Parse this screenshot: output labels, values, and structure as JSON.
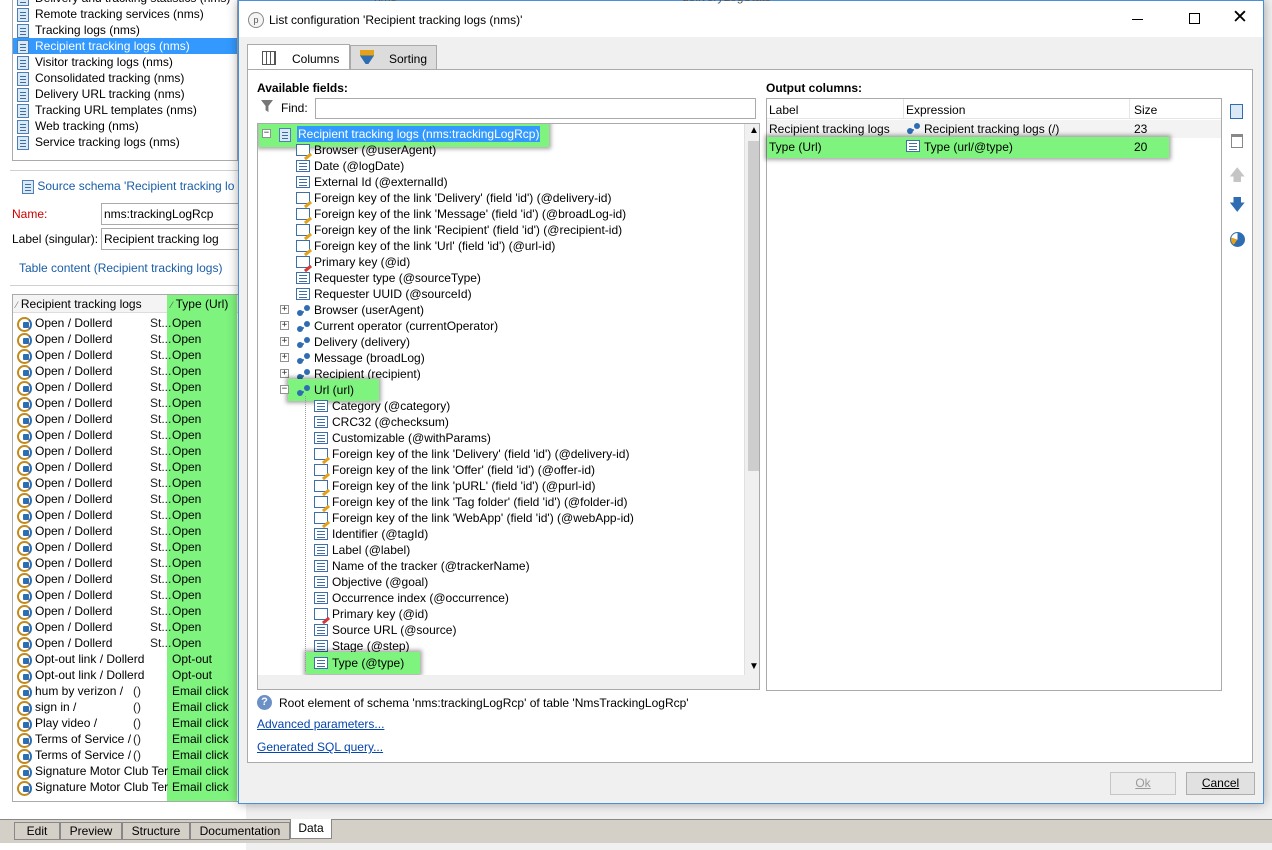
{
  "left_panel": {
    "top_items": [
      {
        "label": "Delivery and tracking statistics (nms)",
        "icon": "document-icon",
        "selected": false
      },
      {
        "label": "Remote tracking services (nms)",
        "icon": "document-icon",
        "selected": false
      },
      {
        "label": "Tracking logs (nms)",
        "icon": "document-icon",
        "selected": false
      },
      {
        "label": "Recipient tracking logs (nms)",
        "icon": "document-icon",
        "selected": true
      },
      {
        "label": "Visitor tracking logs (nms)",
        "icon": "document-icon",
        "selected": false
      },
      {
        "label": "Consolidated tracking (nms)",
        "icon": "document-icon",
        "selected": false
      },
      {
        "label": "Delivery URL tracking (nms)",
        "icon": "user-document-icon",
        "selected": false
      },
      {
        "label": "Tracking URL templates (nms)",
        "icon": "document-icon",
        "selected": false
      },
      {
        "label": "Web tracking (nms)",
        "icon": "document-icon",
        "selected": false
      },
      {
        "label": "Service tracking logs (nms)",
        "icon": "document-icon",
        "selected": false
      }
    ],
    "bg_col2_texts": [
      "nms",
      "deliveryLogStats"
    ],
    "source_schema_link": "Source schema 'Recipient tracking lo",
    "name_label": "Name:",
    "name_value": "nms:trackingLogRcp",
    "label_singular_label": "Label (singular):",
    "label_singular_value": "Recipient tracking log",
    "table_content_label": "Table content (Recipient tracking logs)",
    "grid_headers": [
      "Recipient tracking logs",
      "Type (Url)"
    ],
    "grid_rows": [
      {
        "c1": "Open / Dollerd",
        "c2": "St...",
        "c3": "Open"
      },
      {
        "c1": "Open / Dollerd",
        "c2": "St...",
        "c3": "Open"
      },
      {
        "c1": "Open / Dollerd",
        "c2": "St...",
        "c3": "Open"
      },
      {
        "c1": "Open / Dollerd",
        "c2": "St...",
        "c3": "Open"
      },
      {
        "c1": "Open / Dollerd",
        "c2": "St...",
        "c3": "Open"
      },
      {
        "c1": "Open / Dollerd",
        "c2": "St...",
        "c3": "Open"
      },
      {
        "c1": "Open / Dollerd",
        "c2": "St...",
        "c3": "Open"
      },
      {
        "c1": "Open / Dollerd",
        "c2": "St...",
        "c3": "Open"
      },
      {
        "c1": "Open / Dollerd",
        "c2": "St...",
        "c3": "Open"
      },
      {
        "c1": "Open / Dollerd",
        "c2": "St...",
        "c3": "Open"
      },
      {
        "c1": "Open / Dollerd",
        "c2": "St...",
        "c3": "Open"
      },
      {
        "c1": "Open / Dollerd",
        "c2": "St...",
        "c3": "Open"
      },
      {
        "c1": "Open / Dollerd",
        "c2": "St...",
        "c3": "Open"
      },
      {
        "c1": "Open / Dollerd",
        "c2": "St...",
        "c3": "Open"
      },
      {
        "c1": "Open / Dollerd",
        "c2": "St...",
        "c3": "Open"
      },
      {
        "c1": "Open / Dollerd",
        "c2": "St...",
        "c3": "Open"
      },
      {
        "c1": "Open / Dollerd",
        "c2": "St...",
        "c3": "Open"
      },
      {
        "c1": "Open / Dollerd",
        "c2": "St...",
        "c3": "Open"
      },
      {
        "c1": "Open / Dollerd",
        "c2": "St...",
        "c3": "Open"
      },
      {
        "c1": "Open / Dollerd",
        "c2": "St...",
        "c3": "Open"
      },
      {
        "c1": "Open / Dollerd",
        "c2": "St...",
        "c3": "Open"
      },
      {
        "c1": "Opt-out link / Dollerd",
        "c2": "",
        "c3": "Opt-out"
      },
      {
        "c1": "Opt-out link / Dollerd",
        "c2": "",
        "c3": "Opt-out"
      },
      {
        "c1": "hum by verizon /",
        "c2": "()",
        "c3": "Email click"
      },
      {
        "c1": "sign in /",
        "c2": "()",
        "c3": "Email click"
      },
      {
        "c1": "Play video /",
        "c2": "()",
        "c3": "Email click"
      },
      {
        "c1": "Terms of Service /",
        "c2": "()",
        "c3": "Email click"
      },
      {
        "c1": "Terms of Service /",
        "c2": "()",
        "c3": "Email click"
      },
      {
        "c1": "Signature Motor Club Ter",
        "c2": "",
        "c3": "Email click"
      },
      {
        "c1": "Signature Motor Club Ter",
        "c2": "",
        "c3": "Email click"
      }
    ],
    "bottom_tabs": [
      "Edit",
      "Preview",
      "Structure",
      "Documentation",
      "Data"
    ],
    "active_bottom_tab": "Data"
  },
  "dialog": {
    "title": "List configuration 'Recipient tracking logs (nms)'",
    "tabs": [
      "Columns",
      "Sorting"
    ],
    "available_fields_label": "Available fields:",
    "find_label": "Find:",
    "find_value": "",
    "output_columns_label": "Output columns:",
    "output_headers": [
      "Label",
      "Expression",
      "Size"
    ],
    "output_rows": [
      {
        "label": "Recipient tracking logs",
        "expression": "Recipient tracking logs (/)",
        "size": "23",
        "highlight": false
      },
      {
        "label": "Type (Url)",
        "expression": "Type (url/@type)",
        "size": "20",
        "highlight": true
      }
    ],
    "tree": [
      {
        "label": "Recipient tracking logs (nms:trackingLogRcp)",
        "level": 0,
        "icon": "root",
        "expander": "-",
        "highlight": true
      },
      {
        "label": "Browser (@userAgent)",
        "level": 1,
        "icon": "key"
      },
      {
        "label": "Date (@logDate)",
        "level": 1,
        "icon": "field"
      },
      {
        "label": "External Id (@externalId)",
        "level": 1,
        "icon": "field"
      },
      {
        "label": "Foreign key of the link 'Delivery' (field 'id') (@delivery-id)",
        "level": 1,
        "icon": "key"
      },
      {
        "label": "Foreign key of the link 'Message' (field 'id') (@broadLog-id)",
        "level": 1,
        "icon": "key"
      },
      {
        "label": "Foreign key of the link 'Recipient' (field 'id') (@recipient-id)",
        "level": 1,
        "icon": "key"
      },
      {
        "label": "Foreign key of the link 'Url' (field 'id') (@url-id)",
        "level": 1,
        "icon": "key"
      },
      {
        "label": "Primary key (@id)",
        "level": 1,
        "icon": "pk"
      },
      {
        "label": "Requester type (@sourceType)",
        "level": 1,
        "icon": "field"
      },
      {
        "label": "Requester UUID (@sourceId)",
        "level": 1,
        "icon": "field"
      },
      {
        "label": "Browser (userAgent)",
        "level": 1,
        "icon": "link",
        "expander": "+"
      },
      {
        "label": "Current operator (currentOperator)",
        "level": 1,
        "icon": "link",
        "expander": "+"
      },
      {
        "label": "Delivery (delivery)",
        "level": 1,
        "icon": "link",
        "expander": "+"
      },
      {
        "label": "Message (broadLog)",
        "level": 1,
        "icon": "link",
        "expander": "+"
      },
      {
        "label": "Recipient (recipient)",
        "level": 1,
        "icon": "link",
        "expander": "+"
      },
      {
        "label": "Url (url)",
        "level": 1,
        "icon": "link",
        "expander": "-",
        "highlight": true
      },
      {
        "label": "Category (@category)",
        "level": 2,
        "icon": "field"
      },
      {
        "label": "CRC32 (@checksum)",
        "level": 2,
        "icon": "field"
      },
      {
        "label": "Customizable (@withParams)",
        "level": 2,
        "icon": "field"
      },
      {
        "label": "Foreign key of the link 'Delivery' (field 'id') (@delivery-id)",
        "level": 2,
        "icon": "key"
      },
      {
        "label": "Foreign key of the link 'Offer' (field 'id') (@offer-id)",
        "level": 2,
        "icon": "key"
      },
      {
        "label": "Foreign key of the link 'pURL' (field 'id') (@purl-id)",
        "level": 2,
        "icon": "key"
      },
      {
        "label": "Foreign key of the link 'Tag folder' (field 'id') (@folder-id)",
        "level": 2,
        "icon": "key"
      },
      {
        "label": "Foreign key of the link 'WebApp' (field 'id') (@webApp-id)",
        "level": 2,
        "icon": "key"
      },
      {
        "label": "Identifier (@tagId)",
        "level": 2,
        "icon": "field"
      },
      {
        "label": "Label (@label)",
        "level": 2,
        "icon": "field"
      },
      {
        "label": "Name of the tracker (@trackerName)",
        "level": 2,
        "icon": "field"
      },
      {
        "label": "Objective (@goal)",
        "level": 2,
        "icon": "field"
      },
      {
        "label": "Occurrence index (@occurrence)",
        "level": 2,
        "icon": "field"
      },
      {
        "label": "Primary key (@id)",
        "level": 2,
        "icon": "pk"
      },
      {
        "label": "Source URL (@source)",
        "level": 2,
        "icon": "field"
      },
      {
        "label": "Stage (@step)",
        "level": 2,
        "icon": "field"
      },
      {
        "label": "Type (@type)",
        "level": 2,
        "icon": "field",
        "highlight": true
      }
    ],
    "root_hint": "Root element of schema 'nms:trackingLogRcp' of table 'NmsTrackingLogRcp'",
    "advanced_link": "Advanced parameters...",
    "sql_link": "Generated SQL query...",
    "ok_label": "Ok",
    "cancel_label": "Cancel"
  },
  "colors": {
    "highlight": "#7ef37e",
    "selection": "#3399ff",
    "link": "#0645ad"
  }
}
